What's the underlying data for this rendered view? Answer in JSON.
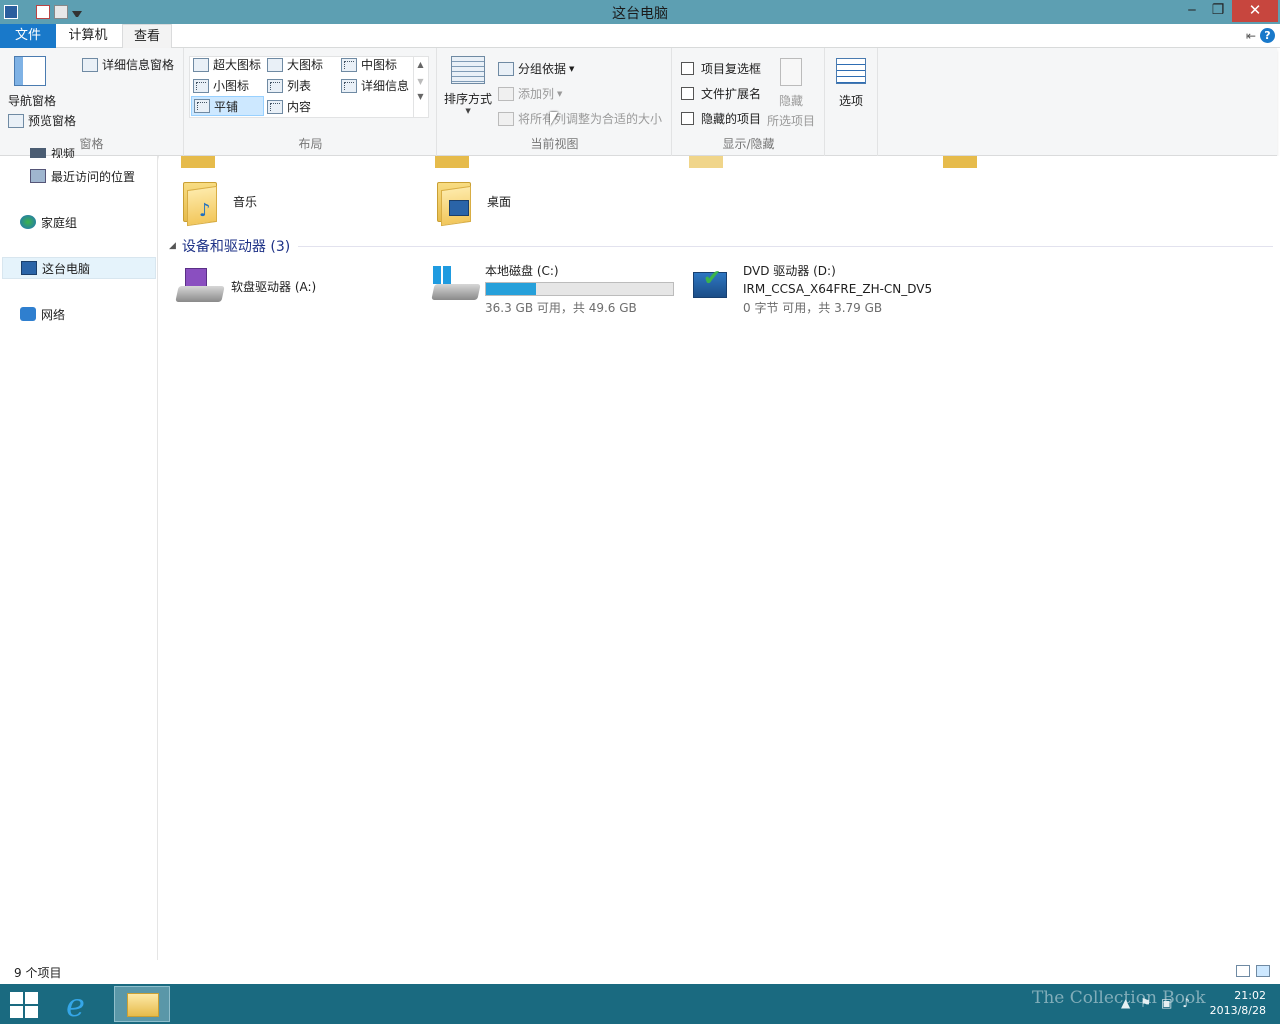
{
  "window": {
    "title": "这台电脑",
    "minimize": "‒",
    "maximize": "❐",
    "close": "✕"
  },
  "tabs": {
    "file": "文件",
    "computer": "计算机",
    "view": "查看"
  },
  "ribbon": {
    "panes": {
      "nav_pane": "导航窗格",
      "preview_pane": "预览窗格",
      "details_pane": "详细信息窗格",
      "label": "窗格"
    },
    "layout": {
      "extra_large": "超大图标",
      "large": "大图标",
      "medium": "中图标",
      "small": "小图标",
      "list": "列表",
      "details": "详细信息",
      "tiles": "平铺",
      "content": "内容",
      "label": "布局"
    },
    "current_view": {
      "sort_by": "排序方式",
      "group_by": "分组依据",
      "add_column": "添加列",
      "fit_columns": "将所有列调整为合适的大小",
      "label": "当前视图"
    },
    "show_hide": {
      "item_checkboxes": "项目复选框",
      "file_extensions": "文件扩展名",
      "hidden_items": "隐藏的项目",
      "hide_selected_1": "隐藏",
      "hide_selected_2": "所选项目",
      "label": "显示/隐藏"
    },
    "options": "选项"
  },
  "nav": {
    "partial": "视频",
    "recent": "最近访问的位置",
    "homegroup": "家庭组",
    "this_pc": "这台电脑",
    "network": "网络"
  },
  "folders": [
    {
      "name": "音乐"
    },
    {
      "name": "桌面"
    }
  ],
  "devices": {
    "heading": "设备和驱动器 (3)",
    "items": [
      {
        "name": "软盘驱动器 (A:)"
      },
      {
        "name": "本地磁盘 (C:)",
        "usage": "36.3 GB 可用，共 49.6 GB",
        "used_fraction": 0.27
      },
      {
        "name": "DVD 驱动器 (D:)",
        "label": "IRM_CCSA_X64FRE_ZH-CN_DV5",
        "usage": "0 字节 可用，共 3.79 GB"
      }
    ]
  },
  "status": {
    "count": "9 个项目"
  },
  "taskbar": {
    "time": "21:02",
    "date": "2013/8/28",
    "watermark": "The Collection Book"
  }
}
